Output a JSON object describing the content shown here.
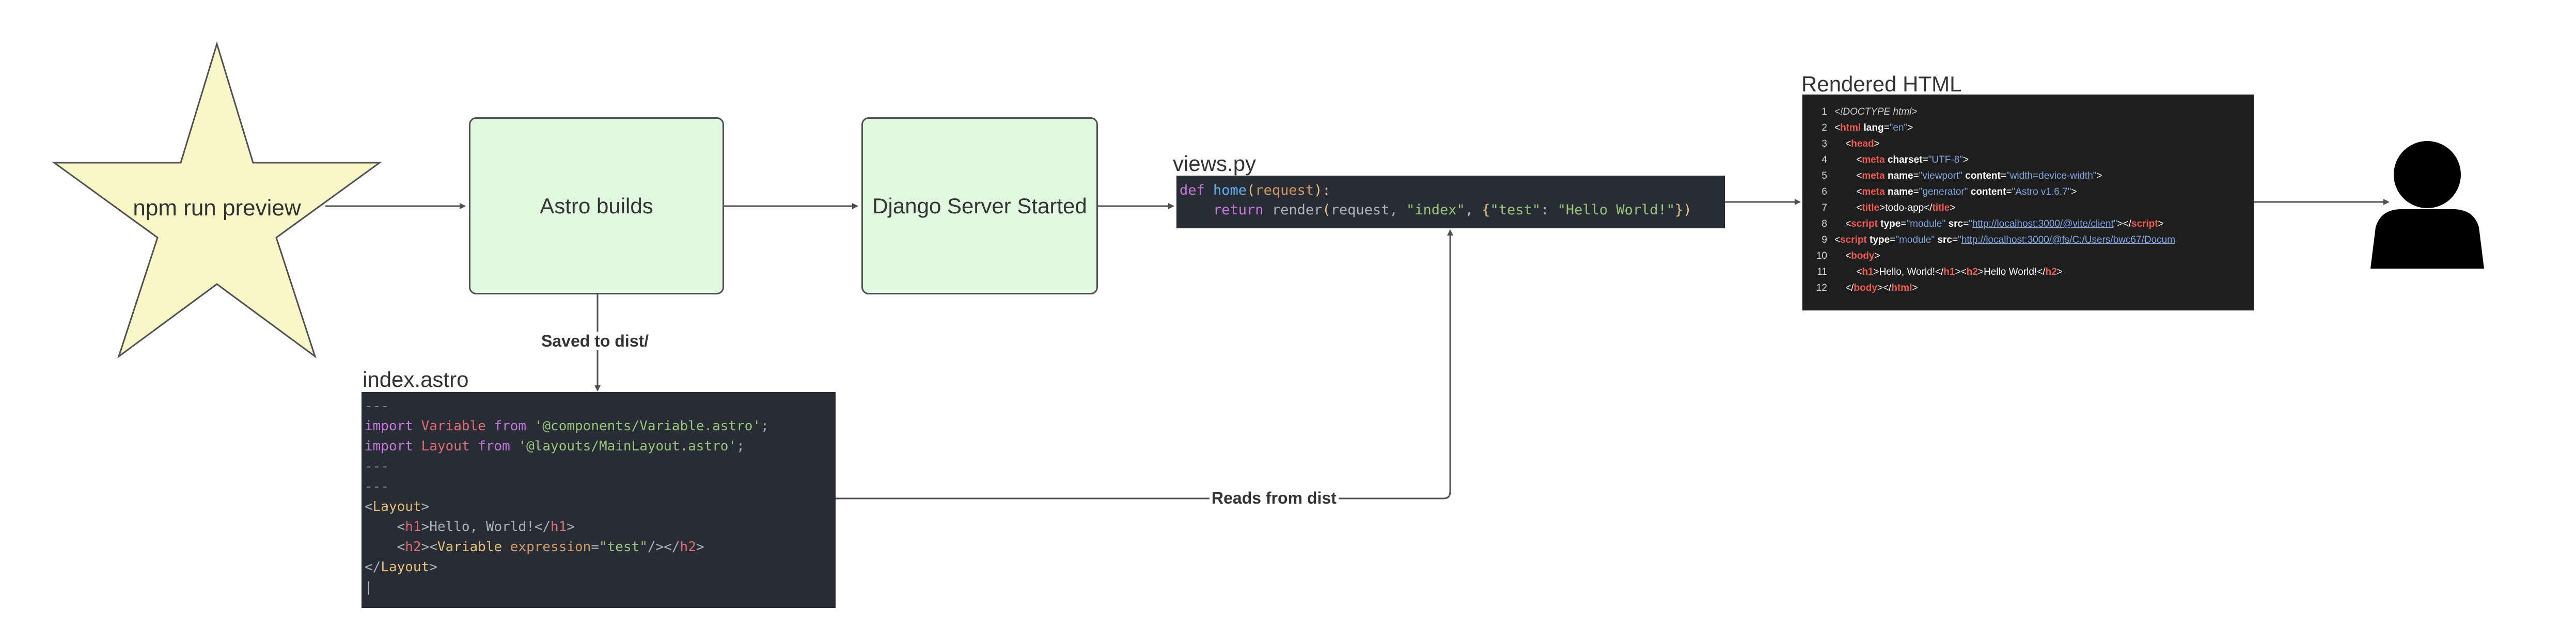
{
  "nodes": {
    "star": {
      "label": "npm run preview"
    },
    "astro": {
      "label": "Astro builds"
    },
    "django": {
      "label": "Django Server Started"
    },
    "views_title": "views.py",
    "index_title": "index.astro",
    "html_title": "Rendered HTML"
  },
  "edge_labels": {
    "saved": "Saved to dist/",
    "reads": "Reads from dist"
  },
  "views_code": [
    [
      [
        "def ",
        "t-keyword"
      ],
      [
        "home",
        "t-func"
      ],
      [
        "(",
        "t-bracket"
      ],
      [
        "request",
        "t-attr"
      ],
      [
        "):",
        "t-bracket"
      ]
    ],
    [
      [
        "    return ",
        "t-keyword"
      ],
      [
        "render",
        "t-plain"
      ],
      [
        "(",
        "t-bracket"
      ],
      [
        "request, ",
        "t-plain"
      ],
      [
        "\"index\"",
        "t-string"
      ],
      [
        ", ",
        "t-plain"
      ],
      [
        "{",
        "t-bracket"
      ],
      [
        "\"test\"",
        "t-string"
      ],
      [
        ": ",
        "t-plain"
      ],
      [
        "\"Hello World!\"",
        "t-string"
      ],
      [
        "})",
        "t-bracket"
      ]
    ]
  ],
  "index_code": [
    [
      [
        "---",
        "t-comment"
      ]
    ],
    [
      [
        "import ",
        "t-keyword"
      ],
      [
        "Variable ",
        "t-tag"
      ],
      [
        "from ",
        "t-keyword"
      ],
      [
        "'@components/Variable.astro'",
        "t-string"
      ],
      [
        ";",
        "t-plain"
      ]
    ],
    [
      [
        "import ",
        "t-keyword"
      ],
      [
        "Layout ",
        "t-tag"
      ],
      [
        "from ",
        "t-keyword"
      ],
      [
        "'@layouts/MainLayout.astro'",
        "t-string"
      ],
      [
        ";",
        "t-plain"
      ]
    ],
    [
      [
        "---",
        "t-comment"
      ]
    ],
    [
      [
        "---",
        "t-comment"
      ]
    ],
    [
      [
        "",
        "t-plain"
      ]
    ],
    [
      [
        "<",
        "t-plain"
      ],
      [
        "Layout",
        "t-bracket"
      ],
      [
        ">",
        "t-plain"
      ]
    ],
    [
      [
        "    <",
        "t-plain"
      ],
      [
        "h1",
        "t-tag"
      ],
      [
        ">Hello, World!</",
        "t-plain"
      ],
      [
        "h1",
        "t-tag"
      ],
      [
        ">",
        "t-plain"
      ]
    ],
    [
      [
        "    <",
        "t-plain"
      ],
      [
        "h2",
        "t-tag"
      ],
      [
        "><",
        "t-plain"
      ],
      [
        "Variable ",
        "t-bracket"
      ],
      [
        "expression",
        "t-attr"
      ],
      [
        "=",
        "t-plain"
      ],
      [
        "\"test\"",
        "t-string"
      ],
      [
        "/></",
        "t-plain"
      ],
      [
        "h2",
        "t-tag"
      ],
      [
        ">",
        "t-plain"
      ]
    ],
    [
      [
        "</",
        "t-plain"
      ],
      [
        "Layout",
        "t-bracket"
      ],
      [
        ">",
        "t-plain"
      ]
    ],
    [
      [
        "|",
        "t-plain"
      ]
    ]
  ],
  "html_code": [
    {
      "num": "1",
      "tokens": [
        [
          "<!DOCTYPE html>",
          "h-doc"
        ]
      ]
    },
    {
      "num": "2",
      "tokens": [
        [
          "<",
          "h-punct"
        ],
        [
          "html ",
          "h-tag"
        ],
        [
          "lang",
          "h-attr"
        ],
        [
          "=",
          "h-punct"
        ],
        [
          "\"en\"",
          "h-val"
        ],
        [
          ">",
          "h-punct"
        ]
      ]
    },
    {
      "num": "3",
      "tokens": [
        [
          "    <",
          "h-punct"
        ],
        [
          "head",
          "h-tag"
        ],
        [
          ">",
          "h-punct"
        ]
      ]
    },
    {
      "num": "4",
      "tokens": [
        [
          "        <",
          "h-punct"
        ],
        [
          "meta ",
          "h-tag"
        ],
        [
          "charset",
          "h-attr"
        ],
        [
          "=",
          "h-punct"
        ],
        [
          "\"UTF-8\"",
          "h-val"
        ],
        [
          ">",
          "h-punct"
        ]
      ]
    },
    {
      "num": "5",
      "tokens": [
        [
          "        <",
          "h-punct"
        ],
        [
          "meta ",
          "h-tag"
        ],
        [
          "name",
          "h-attr"
        ],
        [
          "=",
          "h-punct"
        ],
        [
          "\"viewport\" ",
          "h-val"
        ],
        [
          "content",
          "h-attr"
        ],
        [
          "=",
          "h-punct"
        ],
        [
          "\"width=device-width\"",
          "h-val"
        ],
        [
          ">",
          "h-punct"
        ]
      ]
    },
    {
      "num": "6",
      "tokens": [
        [
          "        <",
          "h-punct"
        ],
        [
          "meta ",
          "h-tag"
        ],
        [
          "name",
          "h-attr"
        ],
        [
          "=",
          "h-punct"
        ],
        [
          "\"generator\" ",
          "h-val"
        ],
        [
          "content",
          "h-attr"
        ],
        [
          "=",
          "h-punct"
        ],
        [
          "\"Astro v1.6.7\"",
          "h-val"
        ],
        [
          ">",
          "h-punct"
        ]
      ]
    },
    {
      "num": "7",
      "tokens": [
        [
          "        <",
          "h-punct"
        ],
        [
          "title",
          "h-tag"
        ],
        [
          ">todo-app</",
          "h-text"
        ],
        [
          "title",
          "h-tag"
        ],
        [
          ">",
          "h-punct"
        ]
      ]
    },
    {
      "num": "8",
      "tokens": [
        [
          "    <",
          "h-punct"
        ],
        [
          "script ",
          "h-tag"
        ],
        [
          "type",
          "h-attr"
        ],
        [
          "=",
          "h-punct"
        ],
        [
          "\"module\" ",
          "h-val"
        ],
        [
          "src",
          "h-attr"
        ],
        [
          "=",
          "h-punct"
        ],
        [
          "\"",
          "h-val"
        ],
        [
          "http://localhost:3000/@vite/client",
          "h-link"
        ],
        [
          "\"",
          "h-val"
        ],
        [
          "></",
          "h-punct"
        ],
        [
          "script",
          "h-tag"
        ],
        [
          ">",
          "h-punct"
        ]
      ]
    },
    {
      "num": "9",
      "tokens": [
        [
          "<",
          "h-punct"
        ],
        [
          "script ",
          "h-tag"
        ],
        [
          "type",
          "h-attr"
        ],
        [
          "=",
          "h-punct"
        ],
        [
          "\"module\" ",
          "h-val"
        ],
        [
          "src",
          "h-attr"
        ],
        [
          "=",
          "h-punct"
        ],
        [
          "\"",
          "h-val"
        ],
        [
          "http://localhost:3000/@fs/C:/Users/bwc67/Docum",
          "h-link"
        ]
      ]
    },
    {
      "num": "10",
      "tokens": [
        [
          "    <",
          "h-punct"
        ],
        [
          "body",
          "h-tag"
        ],
        [
          ">",
          "h-punct"
        ]
      ]
    },
    {
      "num": "11",
      "tokens": [
        [
          "        <",
          "h-punct"
        ],
        [
          "h1",
          "h-tag"
        ],
        [
          ">Hello, World!</",
          "h-text"
        ],
        [
          "h1",
          "h-tag"
        ],
        [
          "><",
          "h-punct"
        ],
        [
          "h2",
          "h-tag"
        ],
        [
          ">Hello World!</",
          "h-text"
        ],
        [
          "h2",
          "h-tag"
        ],
        [
          ">",
          "h-punct"
        ]
      ]
    },
    {
      "num": "12",
      "tokens": [
        [
          "    </",
          "h-punct"
        ],
        [
          "body",
          "h-tag"
        ],
        [
          "></",
          "h-punct"
        ],
        [
          "html",
          "h-tag"
        ],
        [
          ">",
          "h-punct"
        ]
      ]
    }
  ],
  "colors": {
    "node_fill": "#dff8df",
    "star_fill": "#f8f7c8",
    "code_bg": "#282c34",
    "html_bg": "#1e1e1e",
    "line": "#505050"
  },
  "icons": {
    "user": "user-icon"
  }
}
